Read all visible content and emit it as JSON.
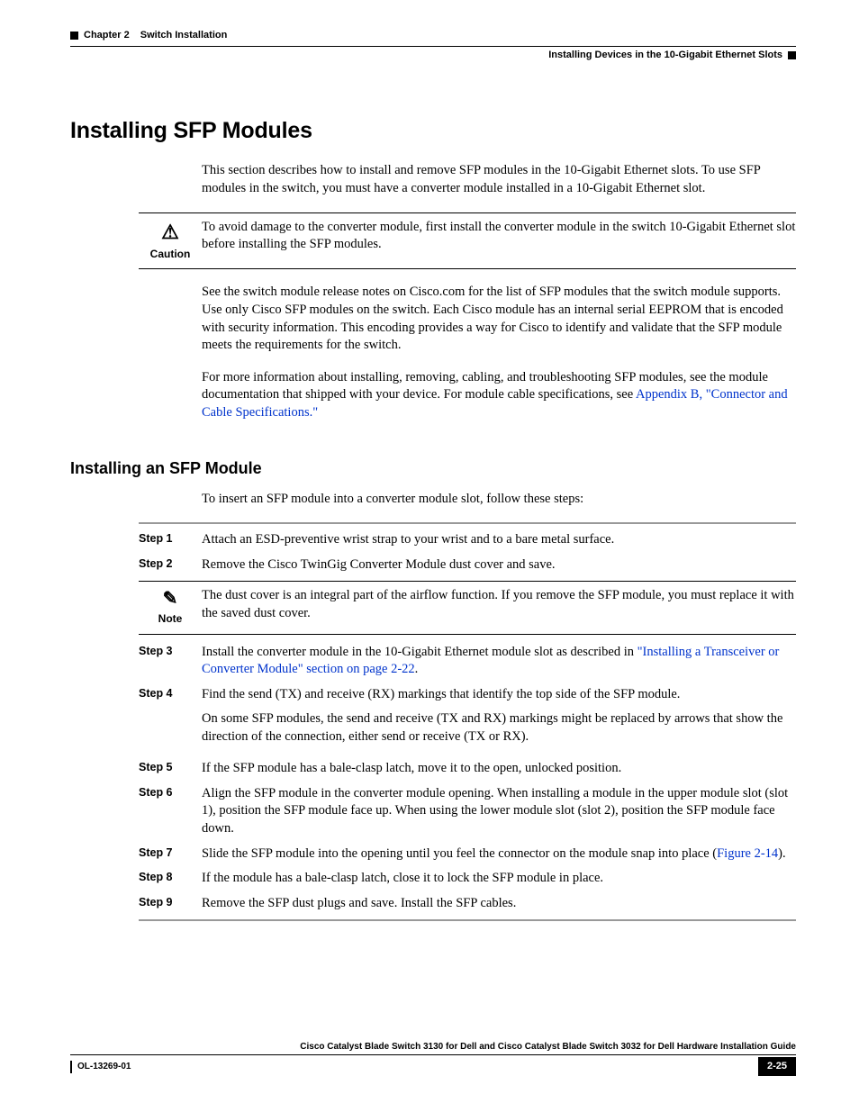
{
  "header": {
    "chapter_label": "Chapter 2",
    "chapter_title": "Switch Installation",
    "section_title": "Installing Devices in the 10-Gigabit Ethernet Slots"
  },
  "h1": "Installing SFP Modules",
  "intro_p1": "This section describes how to install and remove SFP modules in the 10-Gigabit Ethernet slots. To use SFP modules in the switch, you must have a converter module installed in a 10-Gigabit Ethernet slot.",
  "caution_label": "Caution",
  "caution_body": "To avoid damage to the converter module, first install the converter module in the switch 10-Gigabit Ethernet slot before installing the SFP modules.",
  "para2": "See the switch module release notes on Cisco.com for the list of SFP modules that the switch module supports. Use only Cisco SFP modules on the switch. Each Cisco module has an internal serial EEPROM that is encoded with security information. This encoding provides a way for Cisco to identify and validate that the SFP module meets the requirements for the switch.",
  "para3_pre": "For more information about installing, removing, cabling, and troubleshooting SFP modules, see the module documentation that shipped with your device. For module cable specifications, see ",
  "para3_link": "Appendix B, \"Connector and Cable Specifications.\"",
  "h2": "Installing an SFP Module",
  "h2_intro": "To insert an SFP module into a converter module slot, follow these steps:",
  "steps": {
    "s1_label": "Step 1",
    "s1": "Attach an ESD-preventive wrist strap to your wrist and to a bare metal surface.",
    "s2_label": "Step 2",
    "s2": "Remove the Cisco TwinGig Converter Module dust cover and save.",
    "note_label": "Note",
    "note_body": "The dust cover is an integral part of the airflow function. If you remove the SFP module, you must replace it with the saved dust cover.",
    "s3_label": "Step 3",
    "s3_pre": "Install the converter module in the 10-Gigabit Ethernet module slot as described in ",
    "s3_link": "\"Installing a Transceiver or Converter Module\" section on page 2-22",
    "s3_post": ".",
    "s4_label": "Step 4",
    "s4_p1": "Find the send (TX) and receive (RX) markings that identify the top side of the SFP module.",
    "s4_p2": "On some SFP modules, the send and receive (TX and RX) markings might be replaced by arrows that show the direction of the connection, either send or receive (TX or RX).",
    "s5_label": "Step 5",
    "s5": "If the SFP module has a bale-clasp latch, move it to the open, unlocked position.",
    "s6_label": "Step 6",
    "s6": "Align the SFP module in the converter module opening. When installing a module in the upper module slot (slot 1), position the SFP module face up. When using the lower module slot (slot 2), position the SFP module face down.",
    "s7_label": "Step 7",
    "s7_pre": "Slide the SFP module into the opening until you feel the connector on the module snap into place (",
    "s7_link": "Figure 2-14",
    "s7_post": ").",
    "s8_label": "Step 8",
    "s8": "If the module has a bale-clasp latch, close it to lock the SFP module in place.",
    "s9_label": "Step 9",
    "s9": "Remove the SFP dust plugs and save. Install the SFP cables."
  },
  "footer": {
    "guide_title": "Cisco Catalyst Blade Switch 3130 for Dell and Cisco Catalyst Blade Switch 3032 for Dell Hardware Installation Guide",
    "doc_id": "OL-13269-01",
    "page_num": "2-25"
  }
}
